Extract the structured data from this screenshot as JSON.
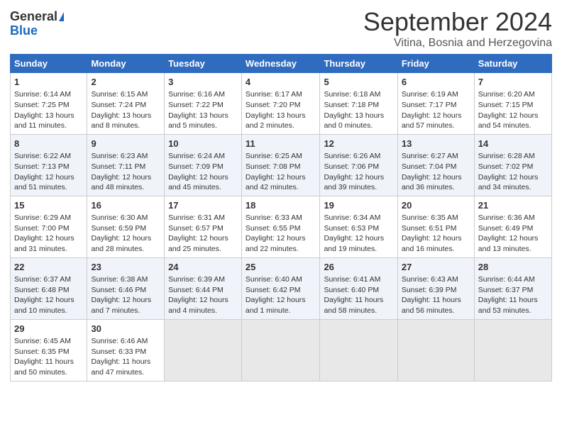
{
  "logo": {
    "general": "General",
    "blue": "Blue"
  },
  "header": {
    "month": "September 2024",
    "location": "Vitina, Bosnia and Herzegovina"
  },
  "days_of_week": [
    "Sunday",
    "Monday",
    "Tuesday",
    "Wednesday",
    "Thursday",
    "Friday",
    "Saturday"
  ],
  "weeks": [
    [
      {
        "num": "1",
        "lines": [
          "Sunrise: 6:14 AM",
          "Sunset: 7:25 PM",
          "Daylight: 13 hours",
          "and 11 minutes."
        ]
      },
      {
        "num": "2",
        "lines": [
          "Sunrise: 6:15 AM",
          "Sunset: 7:24 PM",
          "Daylight: 13 hours",
          "and 8 minutes."
        ]
      },
      {
        "num": "3",
        "lines": [
          "Sunrise: 6:16 AM",
          "Sunset: 7:22 PM",
          "Daylight: 13 hours",
          "and 5 minutes."
        ]
      },
      {
        "num": "4",
        "lines": [
          "Sunrise: 6:17 AM",
          "Sunset: 7:20 PM",
          "Daylight: 13 hours",
          "and 2 minutes."
        ]
      },
      {
        "num": "5",
        "lines": [
          "Sunrise: 6:18 AM",
          "Sunset: 7:18 PM",
          "Daylight: 13 hours",
          "and 0 minutes."
        ]
      },
      {
        "num": "6",
        "lines": [
          "Sunrise: 6:19 AM",
          "Sunset: 7:17 PM",
          "Daylight: 12 hours",
          "and 57 minutes."
        ]
      },
      {
        "num": "7",
        "lines": [
          "Sunrise: 6:20 AM",
          "Sunset: 7:15 PM",
          "Daylight: 12 hours",
          "and 54 minutes."
        ]
      }
    ],
    [
      {
        "num": "8",
        "lines": [
          "Sunrise: 6:22 AM",
          "Sunset: 7:13 PM",
          "Daylight: 12 hours",
          "and 51 minutes."
        ]
      },
      {
        "num": "9",
        "lines": [
          "Sunrise: 6:23 AM",
          "Sunset: 7:11 PM",
          "Daylight: 12 hours",
          "and 48 minutes."
        ]
      },
      {
        "num": "10",
        "lines": [
          "Sunrise: 6:24 AM",
          "Sunset: 7:09 PM",
          "Daylight: 12 hours",
          "and 45 minutes."
        ]
      },
      {
        "num": "11",
        "lines": [
          "Sunrise: 6:25 AM",
          "Sunset: 7:08 PM",
          "Daylight: 12 hours",
          "and 42 minutes."
        ]
      },
      {
        "num": "12",
        "lines": [
          "Sunrise: 6:26 AM",
          "Sunset: 7:06 PM",
          "Daylight: 12 hours",
          "and 39 minutes."
        ]
      },
      {
        "num": "13",
        "lines": [
          "Sunrise: 6:27 AM",
          "Sunset: 7:04 PM",
          "Daylight: 12 hours",
          "and 36 minutes."
        ]
      },
      {
        "num": "14",
        "lines": [
          "Sunrise: 6:28 AM",
          "Sunset: 7:02 PM",
          "Daylight: 12 hours",
          "and 34 minutes."
        ]
      }
    ],
    [
      {
        "num": "15",
        "lines": [
          "Sunrise: 6:29 AM",
          "Sunset: 7:00 PM",
          "Daylight: 12 hours",
          "and 31 minutes."
        ]
      },
      {
        "num": "16",
        "lines": [
          "Sunrise: 6:30 AM",
          "Sunset: 6:59 PM",
          "Daylight: 12 hours",
          "and 28 minutes."
        ]
      },
      {
        "num": "17",
        "lines": [
          "Sunrise: 6:31 AM",
          "Sunset: 6:57 PM",
          "Daylight: 12 hours",
          "and 25 minutes."
        ]
      },
      {
        "num": "18",
        "lines": [
          "Sunrise: 6:33 AM",
          "Sunset: 6:55 PM",
          "Daylight: 12 hours",
          "and 22 minutes."
        ]
      },
      {
        "num": "19",
        "lines": [
          "Sunrise: 6:34 AM",
          "Sunset: 6:53 PM",
          "Daylight: 12 hours",
          "and 19 minutes."
        ]
      },
      {
        "num": "20",
        "lines": [
          "Sunrise: 6:35 AM",
          "Sunset: 6:51 PM",
          "Daylight: 12 hours",
          "and 16 minutes."
        ]
      },
      {
        "num": "21",
        "lines": [
          "Sunrise: 6:36 AM",
          "Sunset: 6:49 PM",
          "Daylight: 12 hours",
          "and 13 minutes."
        ]
      }
    ],
    [
      {
        "num": "22",
        "lines": [
          "Sunrise: 6:37 AM",
          "Sunset: 6:48 PM",
          "Daylight: 12 hours",
          "and 10 minutes."
        ]
      },
      {
        "num": "23",
        "lines": [
          "Sunrise: 6:38 AM",
          "Sunset: 6:46 PM",
          "Daylight: 12 hours",
          "and 7 minutes."
        ]
      },
      {
        "num": "24",
        "lines": [
          "Sunrise: 6:39 AM",
          "Sunset: 6:44 PM",
          "Daylight: 12 hours",
          "and 4 minutes."
        ]
      },
      {
        "num": "25",
        "lines": [
          "Sunrise: 6:40 AM",
          "Sunset: 6:42 PM",
          "Daylight: 12 hours",
          "and 1 minute."
        ]
      },
      {
        "num": "26",
        "lines": [
          "Sunrise: 6:41 AM",
          "Sunset: 6:40 PM",
          "Daylight: 11 hours",
          "and 58 minutes."
        ]
      },
      {
        "num": "27",
        "lines": [
          "Sunrise: 6:43 AM",
          "Sunset: 6:39 PM",
          "Daylight: 11 hours",
          "and 56 minutes."
        ]
      },
      {
        "num": "28",
        "lines": [
          "Sunrise: 6:44 AM",
          "Sunset: 6:37 PM",
          "Daylight: 11 hours",
          "and 53 minutes."
        ]
      }
    ],
    [
      {
        "num": "29",
        "lines": [
          "Sunrise: 6:45 AM",
          "Sunset: 6:35 PM",
          "Daylight: 11 hours",
          "and 50 minutes."
        ]
      },
      {
        "num": "30",
        "lines": [
          "Sunrise: 6:46 AM",
          "Sunset: 6:33 PM",
          "Daylight: 11 hours",
          "and 47 minutes."
        ]
      },
      {
        "num": "",
        "lines": [],
        "empty": true
      },
      {
        "num": "",
        "lines": [],
        "empty": true
      },
      {
        "num": "",
        "lines": [],
        "empty": true
      },
      {
        "num": "",
        "lines": [],
        "empty": true
      },
      {
        "num": "",
        "lines": [],
        "empty": true
      }
    ]
  ]
}
